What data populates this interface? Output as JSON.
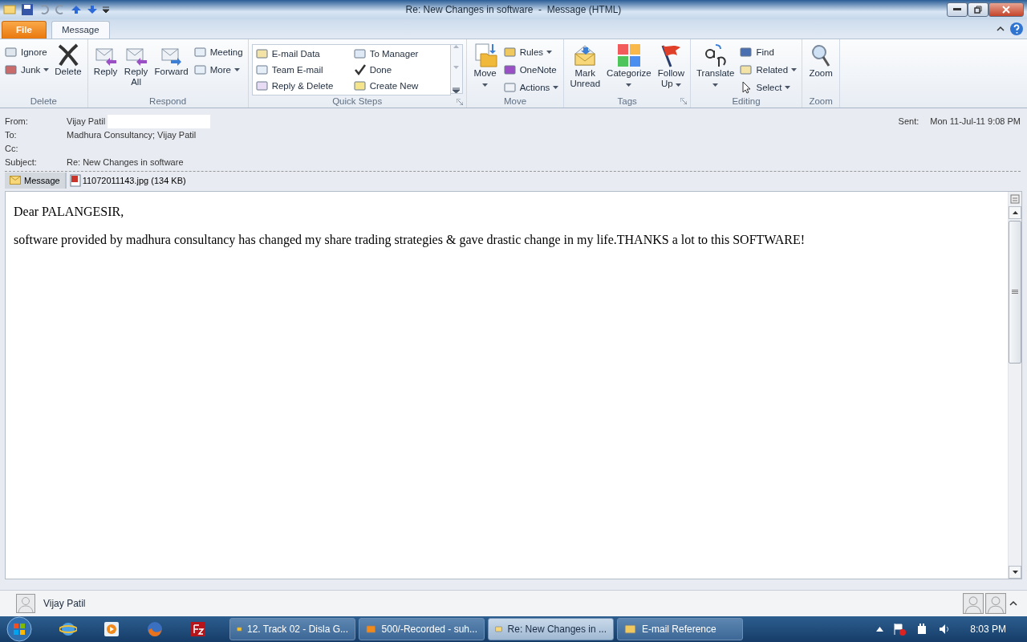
{
  "window": {
    "title": "Re: New Changes in software  -  Message (HTML)"
  },
  "tabs": [
    {
      "label": "File",
      "kind": "file",
      "selected": false
    },
    {
      "label": "Message",
      "kind": "tab",
      "selected": true
    }
  ],
  "ribbon": {
    "groups": [
      {
        "label": "Delete",
        "launcher": false,
        "kind": "buttons",
        "buttons": [
          {
            "kind": "small",
            "lines": [
              "Ignore"
            ],
            "dropdown": false
          },
          {
            "kind": "small",
            "lines": [
              "Junk"
            ],
            "dropdown": true
          },
          {
            "kind": "large",
            "lines": [
              "Delete"
            ],
            "dropdown": false
          }
        ]
      },
      {
        "label": "Respond",
        "launcher": false,
        "kind": "buttons",
        "buttons": [
          {
            "kind": "large",
            "lines": [
              "Reply"
            ],
            "dropdown": false
          },
          {
            "kind": "large",
            "lines": [
              "Reply",
              "All"
            ],
            "dropdown": false
          },
          {
            "kind": "large",
            "lines": [
              "Forward"
            ],
            "dropdown": false
          },
          {
            "kind": "small",
            "lines": [
              "Meeting"
            ],
            "dropdown": false
          },
          {
            "kind": "small",
            "lines": [
              "More"
            ],
            "dropdown": true
          }
        ]
      },
      {
        "label": "Quick Steps",
        "launcher": true,
        "kind": "gallery",
        "buttons": [
          {
            "kind": "small",
            "lines": [
              "E-mail Data"
            ],
            "dropdown": false
          },
          {
            "kind": "small",
            "lines": [
              "To Manager"
            ],
            "dropdown": false
          },
          {
            "kind": "small",
            "lines": [
              "Team E-mail"
            ],
            "dropdown": false
          },
          {
            "kind": "small",
            "lines": [
              "Done"
            ],
            "dropdown": false
          },
          {
            "kind": "small",
            "lines": [
              "Reply & Delete"
            ],
            "dropdown": false
          },
          {
            "kind": "small",
            "lines": [
              "Create New"
            ],
            "dropdown": false
          }
        ]
      },
      {
        "label": "Move",
        "launcher": false,
        "kind": "buttons",
        "buttons": [
          {
            "kind": "large",
            "lines": [
              "Move"
            ],
            "dropdown": true
          },
          {
            "kind": "small",
            "lines": [
              "Rules"
            ],
            "dropdown": true
          },
          {
            "kind": "small",
            "lines": [
              "OneNote"
            ],
            "dropdown": false
          },
          {
            "kind": "small",
            "lines": [
              "Actions"
            ],
            "dropdown": true
          }
        ]
      },
      {
        "label": "Tags",
        "launcher": true,
        "kind": "buttons",
        "buttons": [
          {
            "kind": "large",
            "lines": [
              "Mark",
              "Unread"
            ],
            "dropdown": false
          },
          {
            "kind": "large",
            "lines": [
              "Categorize"
            ],
            "dropdown": true
          },
          {
            "kind": "large",
            "lines": [
              "Follow",
              "Up"
            ],
            "dropdown": true
          }
        ]
      },
      {
        "label": "Editing",
        "launcher": false,
        "kind": "buttons",
        "buttons": [
          {
            "kind": "large",
            "lines": [
              "Translate"
            ],
            "dropdown": true
          },
          {
            "kind": "small",
            "lines": [
              "Find"
            ],
            "dropdown": false
          },
          {
            "kind": "small",
            "lines": [
              "Related"
            ],
            "dropdown": true
          },
          {
            "kind": "small",
            "lines": [
              "Select"
            ],
            "dropdown": true
          }
        ]
      },
      {
        "label": "Zoom",
        "launcher": false,
        "kind": "buttons",
        "buttons": [
          {
            "kind": "large",
            "lines": [
              "Zoom"
            ],
            "dropdown": false
          }
        ]
      }
    ]
  },
  "header": {
    "fields": [
      {
        "label": "From:",
        "value": "Vijay Patil",
        "redacted": true
      },
      {
        "label": "To:",
        "value": "Madhura Consultancy; Vijay Patil",
        "redacted": false
      },
      {
        "label": "Cc:",
        "redacted": false
      },
      {
        "label": "Subject:",
        "value": "Re: New Changes in software",
        "redacted": false
      }
    ],
    "sent": {
      "label": "Sent:",
      "value": "Mon 11-Jul-11 9:08 PM"
    }
  },
  "attachments": {
    "message_tab": {
      "label": "Message",
      "selected": true
    },
    "files": [
      {
        "label": "11072011143.jpg (134 KB)"
      }
    ]
  },
  "body": {
    "paragraphs": [
      "Dear PALANGESIR,",
      "software provided by madhura consultancy has changed my share trading strategies & gave drastic change in my life.THANKS a lot to this SOFTWARE!"
    ]
  },
  "people_pane": {
    "name": "Vijay Patil"
  },
  "taskbar": {
    "buttons": [
      {
        "label": "12. Track 02 - Disla G...",
        "selected": false
      },
      {
        "label": "500/-Recorded - suh...",
        "selected": false
      },
      {
        "label": "Re: New Changes in ...",
        "selected": true
      },
      {
        "label": "E-mail Reference",
        "selected": false
      }
    ],
    "clock": "8:03 PM"
  }
}
